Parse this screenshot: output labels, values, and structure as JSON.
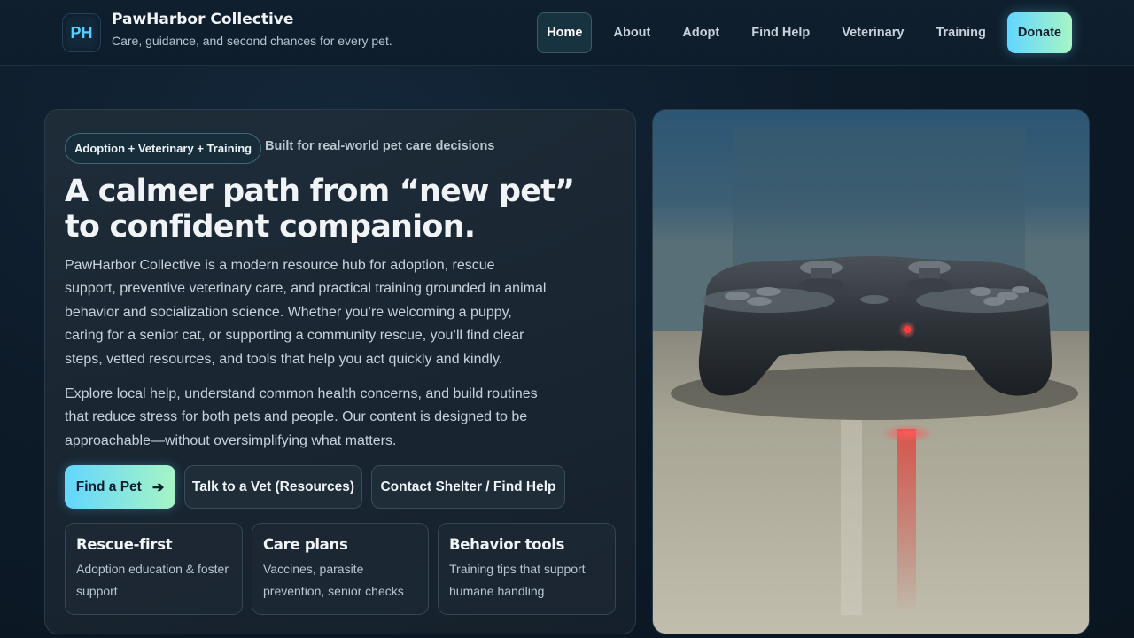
{
  "header": {
    "logo_initials": "PH",
    "brand_name": "PawHarbor Collective",
    "brand_tagline": "Care, guidance, and second chances for every pet.",
    "nav": [
      {
        "label": "Home",
        "active": true
      },
      {
        "label": "About"
      },
      {
        "label": "Adopt"
      },
      {
        "label": "Find Help"
      },
      {
        "label": "Veterinary"
      },
      {
        "label": "Training"
      }
    ],
    "donate_label": "Donate"
  },
  "hero": {
    "pill": "Adoption + Veterinary + Training",
    "pill_note": "Built for real-world pet care decisions",
    "headline": "A calmer path from “new pet” to confident companion.",
    "paragraph_1": "PawHarbor Collective is a modern resource hub for adoption, rescue support, preventive veterinary care, and practical training grounded in animal behavior and socialization science. Whether you’re welcoming a puppy, caring for a senior cat, or supporting a community rescue, you’ll find clear steps, vetted resources, and tools that help you act quickly and kindly.",
    "paragraph_2": "Explore local help, understand common health concerns, and build routines that reduce stress for both pets and people. Our content is designed to be approachable—without oversimplifying what matters.",
    "buttons": {
      "primary": "Find a Pet",
      "primary_icon": "arrow-right-icon",
      "vet": "Talk to a Vet (Resources)",
      "contact": "Contact Shelter / Find Help"
    },
    "features": [
      {
        "title": "Rescue-first",
        "desc": "Adoption education & foster support"
      },
      {
        "title": "Care plans",
        "desc": "Vaccines, parasite prevention, senior checks"
      },
      {
        "title": "Behavior tools",
        "desc": "Training tips that support humane handling"
      }
    ]
  },
  "photo": {
    "subject": "game-controller-photo",
    "colors": {
      "sky": "#2c4f6a",
      "table": "#b8b6a8",
      "controller": "#2a2f35",
      "led": "#ff3b3b"
    }
  }
}
